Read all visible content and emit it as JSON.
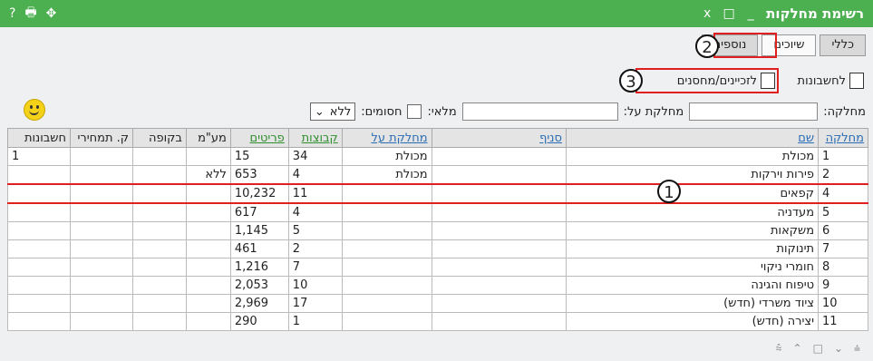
{
  "window": {
    "title": "רשימת מחלקות",
    "left_icons": {
      "help": "?",
      "print": "🖶",
      "move": "✥"
    },
    "controls": {
      "close": "x",
      "restore": "□",
      "minimize": "_"
    }
  },
  "tabs": [
    {
      "label": "כללי"
    },
    {
      "label": "שיוכים",
      "active": true
    },
    {
      "label": "נוספים"
    }
  ],
  "toolbar": {
    "accounts_label": "לחשבונות",
    "creditors_label": "לזכיינים/מחסנים"
  },
  "filters": {
    "department_label": "מחלקה:",
    "department_on_label": "מחלקת על:",
    "full_label": "מלאי:",
    "blocked_label": "חסומים:",
    "blocked_value": "ללא"
  },
  "table": {
    "headers": [
      "מחלקה",
      "שם",
      "סניף",
      "מחלקת על",
      "קבוצות",
      "פריטים",
      "מע\"מ",
      "בקופה",
      "ק. תמחירי",
      "חשבונות"
    ],
    "rows": [
      [
        "1",
        "מכולת",
        "",
        "מכולת",
        "34",
        "15",
        "",
        "",
        "",
        "1"
      ],
      [
        "2",
        "פירות וירקות",
        "",
        "מכולת",
        "4",
        "653",
        "ללא",
        "",
        "",
        ""
      ],
      [
        "4",
        "קפאים",
        "",
        "",
        "11",
        "10,232",
        "",
        "",
        "",
        ""
      ],
      [
        "5",
        "מעדניה",
        "",
        "",
        "4",
        "617",
        "",
        "",
        "",
        ""
      ],
      [
        "6",
        "משקאות",
        "",
        "",
        "5",
        "1,145",
        "",
        "",
        "",
        ""
      ],
      [
        "7",
        "תינוקות",
        "",
        "",
        "2",
        "461",
        "",
        "",
        "",
        ""
      ],
      [
        "8",
        "חומרי ניקוי",
        "",
        "",
        "7",
        "1,216",
        "",
        "",
        "",
        ""
      ],
      [
        "9",
        "טיפוח והגינה",
        "",
        "",
        "10",
        "2,053",
        "",
        "",
        "",
        ""
      ],
      [
        "10",
        "ציוד משרדי (חדש)",
        "",
        "",
        "17",
        "2,969",
        "",
        "",
        "",
        ""
      ],
      [
        "11",
        "יצירה (חדש)",
        "",
        "",
        "1",
        "290",
        "",
        "",
        "",
        ""
      ]
    ]
  },
  "callouts": {
    "one": "1",
    "two": "2",
    "three": "3"
  },
  "colors": {
    "title_bar": "#4caf50",
    "highlight": "#e02020"
  }
}
